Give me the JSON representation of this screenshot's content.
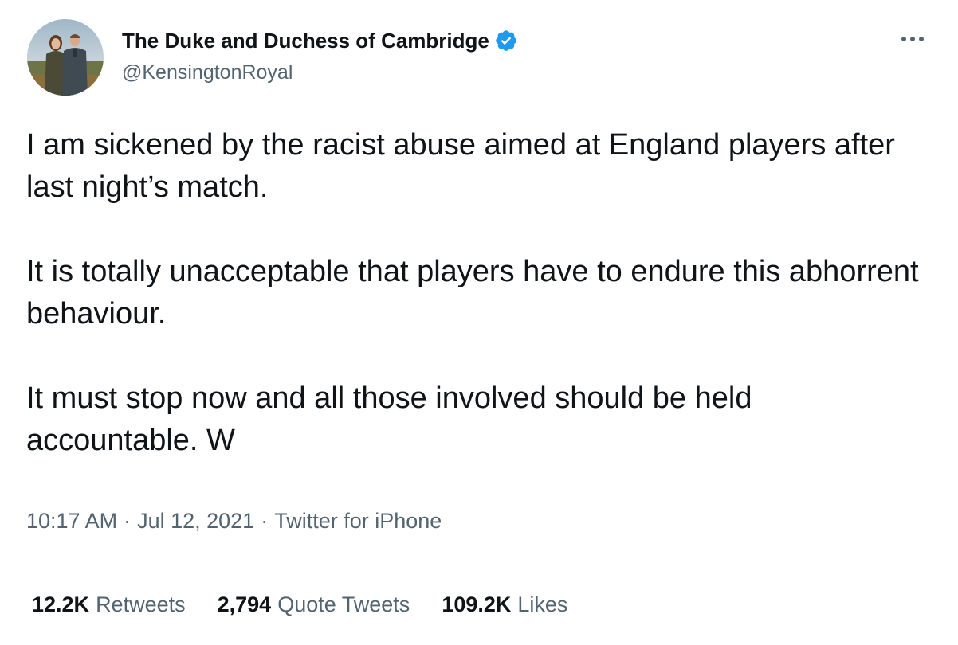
{
  "author": {
    "name": "The Duke and Duchess of Cambridge",
    "handle": "@KensingtonRoyal",
    "verified": true,
    "verified_color": "#1d9bf0",
    "avatar_icon": "couple-photo-avatar"
  },
  "more_icon": "ellipsis-icon",
  "tweet": {
    "paragraphs": [
      "I am sickened by the racist abuse aimed at England players after last night’s match.",
      "It is totally unacceptable that players have to endure this abhorrent behaviour.",
      "It must stop now and all those involved should be held accountable. W"
    ]
  },
  "meta": {
    "time": "10:17 AM",
    "separator": "·",
    "date": "Jul 12, 2021",
    "source": "Twitter for iPhone"
  },
  "stats": {
    "retweets_count": "12.2K",
    "retweets_label": "Retweets",
    "quotes_count": "2,794",
    "quotes_label": "Quote Tweets",
    "likes_count": "109.2K",
    "likes_label": "Likes"
  },
  "colors": {
    "text_primary": "#0f1419",
    "text_secondary": "#536471",
    "divider": "#eff3f4",
    "accent": "#1d9bf0"
  }
}
